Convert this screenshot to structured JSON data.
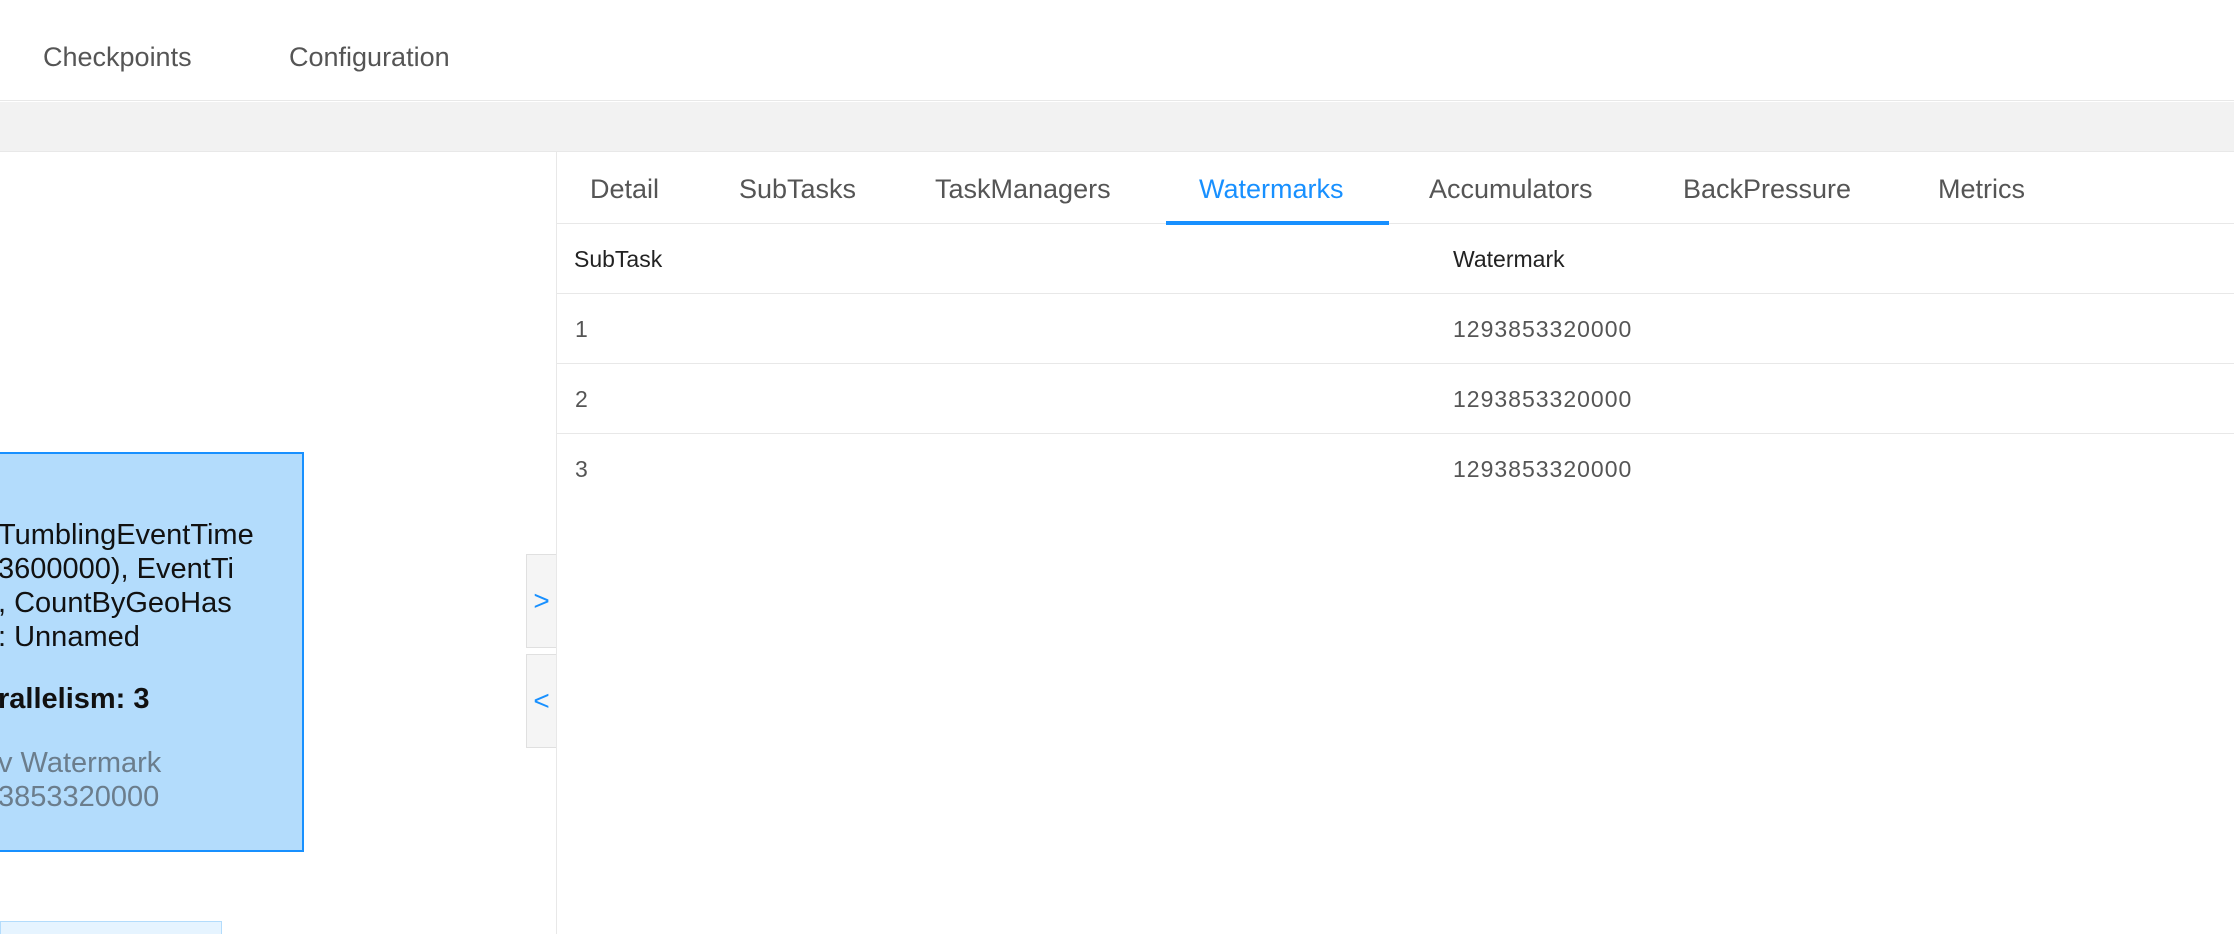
{
  "top_nav": {
    "items": [
      {
        "label": "Checkpoints"
      },
      {
        "label": "Configuration"
      }
    ]
  },
  "plan_node": {
    "description_lines": [
      "TumblingEventTime",
      "3600000), EventTi",
      ", CountByGeoHas",
      ": Unnamed"
    ],
    "parallelism": "rallelism: 3",
    "watermark_lines": [
      "v Watermark",
      "3853320000"
    ]
  },
  "toggles": {
    "expand_icon": "chevron-right-icon",
    "collapse_icon": "chevron-left-icon",
    "expand_glyph": ">",
    "collapse_glyph": "<"
  },
  "tabs": {
    "items": [
      {
        "label": "Detail"
      },
      {
        "label": "SubTasks"
      },
      {
        "label": "TaskManagers"
      },
      {
        "label": "Watermarks"
      },
      {
        "label": "Accumulators"
      },
      {
        "label": "BackPressure"
      },
      {
        "label": "Metrics"
      }
    ],
    "active": "Watermarks"
  },
  "watermarks_table": {
    "columns": [
      "SubTask",
      "Watermark"
    ],
    "rows": [
      [
        "1",
        "1293853320000"
      ],
      [
        "2",
        "1293853320000"
      ],
      [
        "3",
        "1293853320000"
      ]
    ]
  },
  "colors": {
    "accent": "#1890ff",
    "node_fill": "#b3dcfc"
  }
}
